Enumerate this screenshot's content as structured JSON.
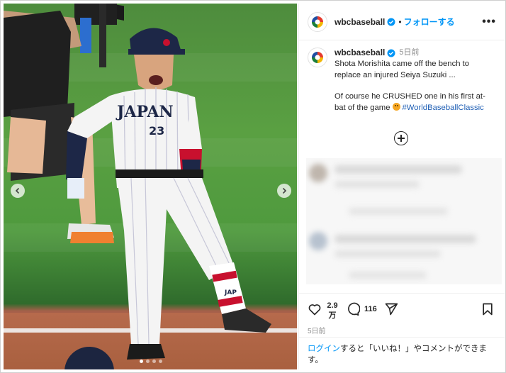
{
  "post": {
    "account": "wbcbaseball",
    "follow_separator": "•",
    "follow_label": "フォローする",
    "more_label": "•••"
  },
  "caption": {
    "username": "wbcbaseball",
    "time": "5日前",
    "line1": "Shota Morishita came off the bench to",
    "line2": "replace an injured Seiya Suzuki ...",
    "line3": "Of course he CRUSHED one in his first at-",
    "line4_pre": "bat of the game",
    "line4_emoji": "flushed-face-emoji",
    "hashtag": "#WorldBaseballClassic"
  },
  "photo": {
    "jersey_text": "JAPAN",
    "jersey_number": "23",
    "leg_guard_text": "JAP",
    "carousel_dots": 4,
    "active_dot": 1
  },
  "actions": {
    "like_count_line1": "2.9",
    "like_count_line2": "万",
    "comment_count": "116",
    "posted": "5日前"
  },
  "login": {
    "link": "ログイン",
    "rest": "すると「いいね！」やコメントができます。"
  },
  "colors": {
    "accent": "#0095f6",
    "hashtag": "#1f5fb5",
    "text": "#262626",
    "muted": "#8e8e8e"
  }
}
